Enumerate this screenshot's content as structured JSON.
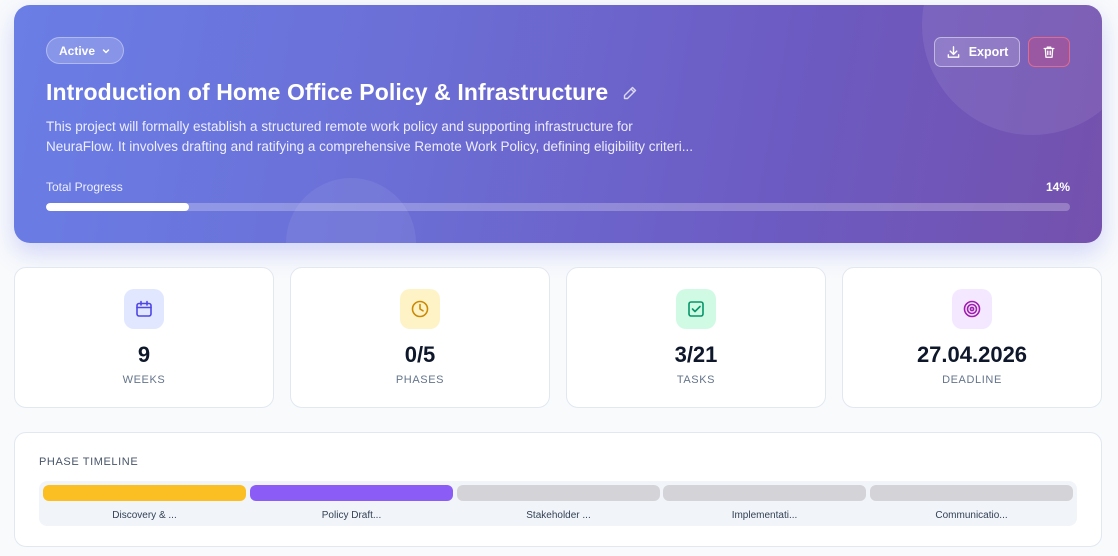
{
  "project": {
    "status": "Active",
    "title": "Introduction of Home Office Policy & Infrastructure",
    "description_line1": "This project will formally establish a structured remote work policy and supporting infrastructure for",
    "description_line2": "NeuraFlow. It involves drafting and ratifying a comprehensive Remote Work Policy, defining eligibility criteri...",
    "export_label": "Export",
    "progress_label": "Total Progress",
    "progress_text": "14%",
    "progress_value": 14
  },
  "stats": [
    {
      "value": "9",
      "label": "WEEKS",
      "icon": "calendar-icon",
      "icon_color": "#4f46e5",
      "icon_bg": "#e0e7ff"
    },
    {
      "value": "0/5",
      "label": "PHASES",
      "icon": "clock-icon",
      "icon_color": "#ca8a04",
      "icon_bg": "#fef3c7"
    },
    {
      "value": "3/21",
      "label": "TASKS",
      "icon": "check-square-icon",
      "icon_color": "#059669",
      "icon_bg": "#d1fae5"
    },
    {
      "value": "27.04.2026",
      "label": "DEADLINE",
      "icon": "target-icon",
      "icon_color": "#a21caf",
      "icon_bg": "#f3e8ff"
    }
  ],
  "timeline": {
    "title": "PHASE TIMELINE",
    "phases": [
      {
        "label": "Discovery & ...",
        "color": "#fbbf24"
      },
      {
        "label": "Policy Draft...",
        "color": "#8b5cf6"
      },
      {
        "label": "Stakeholder ...",
        "color": "#d4d4d8"
      },
      {
        "label": "Implementati...",
        "color": "#d4d4d8"
      },
      {
        "label": "Communicatio...",
        "color": "#d4d4d8"
      }
    ]
  }
}
